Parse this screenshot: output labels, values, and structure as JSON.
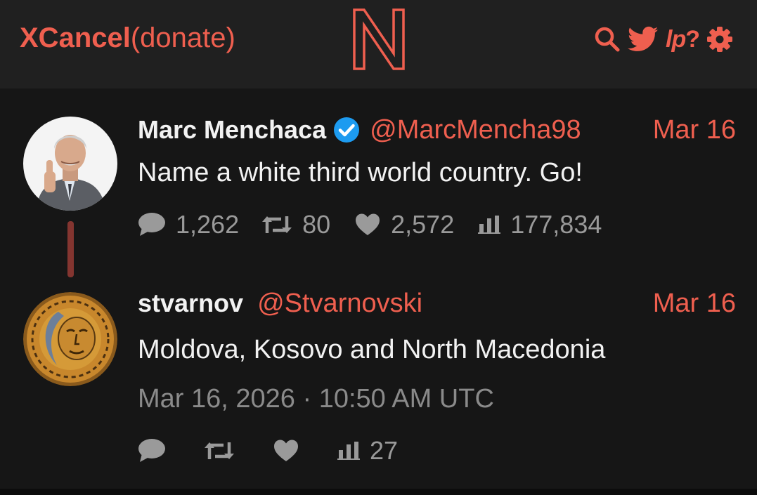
{
  "navbar": {
    "brand_name": "XCancel",
    "brand_donate": "(donate)",
    "logo_letter": "N",
    "icons": [
      "search-icon",
      "bird-icon",
      "lp-icon",
      "help-icon",
      "gear-icon"
    ],
    "lp_label": "lp",
    "help_label": "?"
  },
  "colors": {
    "accent": "#ef5f4f",
    "background": "#161616",
    "navbar": "#202020",
    "thread_line": "#843530",
    "verified": "#1d9bf0",
    "muted": "#9a9a9a"
  },
  "tweets": [
    {
      "fullname": "Marc Menchaca",
      "verified": true,
      "handle": "@MarcMencha98",
      "date": "Mar 16",
      "text": "Name a white third world country. Go!",
      "stats": {
        "replies": "1,262",
        "retweets": "80",
        "likes": "2,572",
        "views": "177,834"
      }
    },
    {
      "fullname": "stvarnov",
      "verified": false,
      "handle": "@Stvarnovski",
      "date": "Mar 16",
      "text": "Moldova, Kosovo and North Macedonia",
      "published": "Mar 16, 2026 · 10:50 AM UTC",
      "stats": {
        "replies": "",
        "retweets": "",
        "likes": "",
        "views": "27"
      }
    }
  ]
}
